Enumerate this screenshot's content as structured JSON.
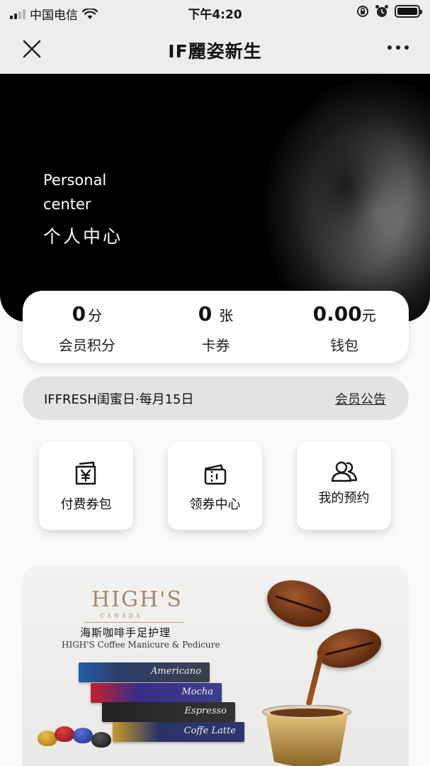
{
  "status_bar": {
    "carrier": "中国电信",
    "time": "下午4:20"
  },
  "nav": {
    "title": "IF麗姿新生",
    "close_icon": "close-icon",
    "more_icon": "more-dots-icon"
  },
  "hero": {
    "title_en_line1": "Personal",
    "title_en_line2": "center",
    "title_cn": "个人中心"
  },
  "stats": [
    {
      "value": "0",
      "unit": "分",
      "label": "会员积分"
    },
    {
      "value": "0",
      "unit": "张",
      "label": "卡券"
    },
    {
      "value": "0.00",
      "unit": "元",
      "label": "钱包"
    }
  ],
  "notice": {
    "text": "IFFRESH闺蜜日·每月15日",
    "link": "会员公告"
  },
  "tiles": [
    {
      "label": "付费券包",
      "icon": "yen-wallet-icon"
    },
    {
      "label": "领券中心",
      "icon": "coupon-icon"
    },
    {
      "label": "我的预约",
      "icon": "users-icon"
    }
  ],
  "banner": {
    "brand": "HIGH'S",
    "brand_sub": "CANADA",
    "title_cn": "海斯咖啡手足护理",
    "title_en": "HIGH'S Coffee Manicure & Pedicure",
    "packs": [
      "Americano",
      "Mocha",
      "Espresso",
      "Coffe Latte"
    ]
  },
  "colors": {
    "nav_bg": "#ededed",
    "brand_gold": "#a5876a",
    "hero_bg": "#000000"
  }
}
